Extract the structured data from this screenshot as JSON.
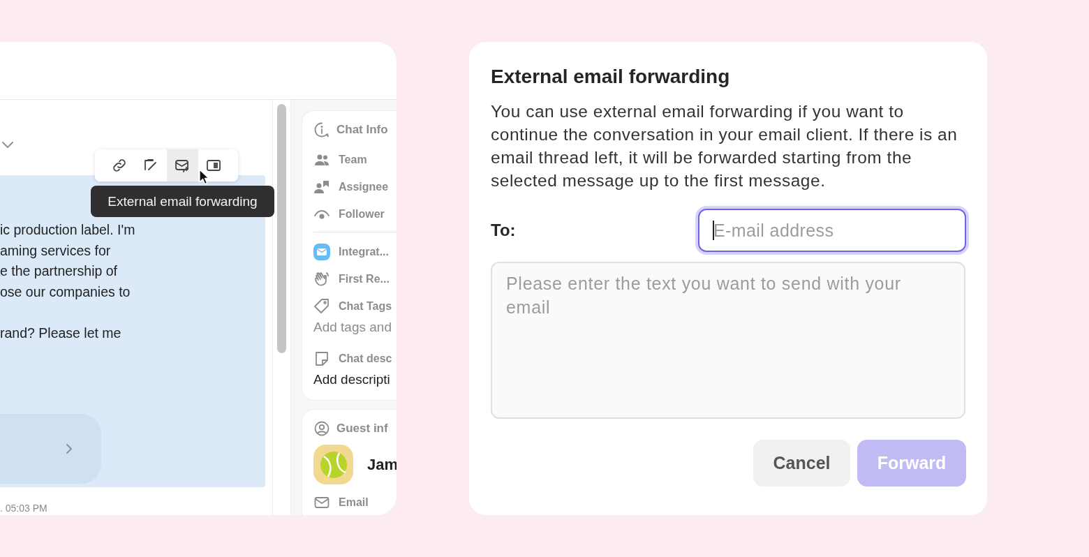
{
  "chat": {
    "message": {
      "paragraphs": [
        [
          "ic production label. I'm",
          "aming services for",
          "e the partnership of",
          "ose our companies to"
        ],
        [
          "rand? Please let me"
        ]
      ],
      "time": ". 05:03 PM"
    },
    "toolbar": [
      {
        "hovered": false
      },
      {
        "hovered": false
      },
      {
        "hovered": true
      },
      {
        "hovered": false
      }
    ],
    "tooltip": "External email forwarding"
  },
  "sidebar": {
    "chat_info": {
      "title": "Chat Info",
      "sections": [
        [
          {
            "kind": "item",
            "label": "Team"
          },
          {
            "kind": "item",
            "label": "Assignee"
          },
          {
            "kind": "item",
            "label": "Follower"
          }
        ],
        [
          {
            "kind": "item",
            "label": "Integrat..."
          },
          {
            "kind": "item",
            "label": "First Re..."
          },
          {
            "kind": "item",
            "label": "Chat Tags"
          },
          {
            "kind": "placeholder",
            "label": "Add tags and"
          },
          {
            "kind": "item",
            "label": "Chat desc"
          },
          {
            "kind": "value",
            "label": "Add descripti"
          }
        ]
      ]
    },
    "guest_info": {
      "title": "Guest inf",
      "name": "Jam",
      "items": [
        {
          "kind": "item",
          "label": "Email"
        }
      ]
    }
  },
  "dialog": {
    "title": "External email forwarding",
    "description": "You can use external email forwarding if you want to continue the conversation in your email client. If there is an email thread left, it will be forwarded starting from the selected message up to the first message.",
    "to_label": "To:",
    "email": {
      "placeholder": "E-mail address",
      "focused": true
    },
    "message": {
      "placeholder": "Please enter the text you want to send with your email"
    },
    "buttons": [
      {
        "kind": "secondary",
        "label": "Cancel",
        "disabled": false
      },
      {
        "kind": "primary",
        "label": "Forward",
        "disabled": true
      }
    ]
  }
}
